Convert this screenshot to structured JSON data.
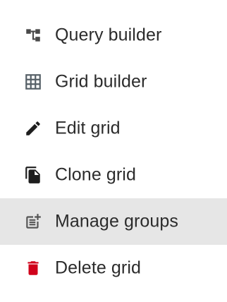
{
  "menu": {
    "items": [
      {
        "label": "Query builder",
        "icon": "query-builder-icon",
        "icon_color": "#4a4a4a",
        "highlighted": false
      },
      {
        "label": "Grid builder",
        "icon": "grid-icon",
        "icon_color": "#555f66",
        "highlighted": false
      },
      {
        "label": "Edit grid",
        "icon": "pencil-icon",
        "icon_color": "#1e1e1e",
        "highlighted": false
      },
      {
        "label": "Clone grid",
        "icon": "copy-icon",
        "icon_color": "#1e1e1e",
        "highlighted": false
      },
      {
        "label": "Manage groups",
        "icon": "post-add-icon",
        "icon_color": "#555555",
        "highlighted": true
      },
      {
        "label": "Delete grid",
        "icon": "trash-icon",
        "icon_color": "#d0021b",
        "highlighted": false
      }
    ],
    "highlight_color": "#e6e6e6"
  }
}
